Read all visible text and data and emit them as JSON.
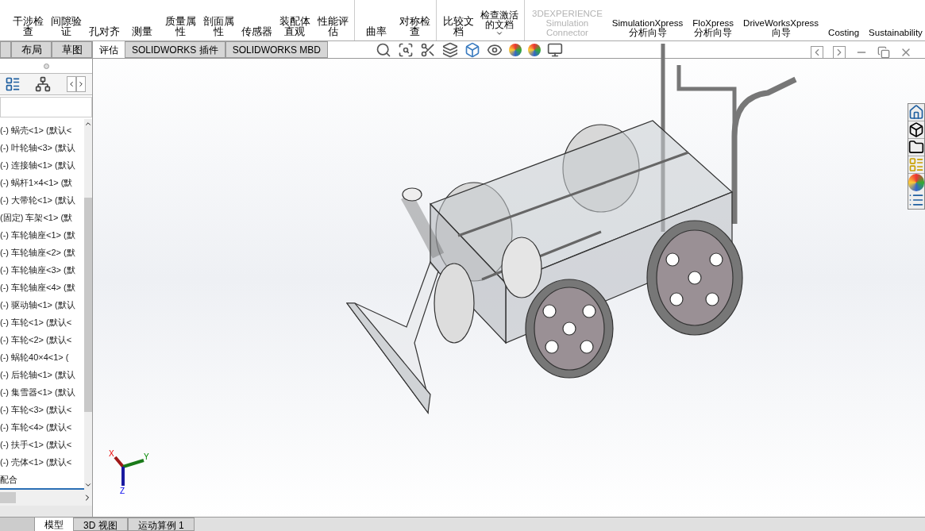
{
  "ribbon": {
    "groups": [
      {
        "kind": "command",
        "tools": [
          {
            "label": "干涉检查",
            "disabled": false,
            "has_menu": false
          },
          {
            "label": "间隙验证",
            "disabled": false,
            "has_menu": false
          },
          {
            "label": "孔对齐",
            "disabled": false,
            "has_menu": false
          },
          {
            "label": "测量",
            "disabled": false,
            "has_menu": false
          },
          {
            "label": "质量属性",
            "disabled": false,
            "has_menu": false
          },
          {
            "label": "剖面属性",
            "disabled": false,
            "has_menu": false
          },
          {
            "label": "传感器",
            "disabled": false,
            "has_menu": false
          },
          {
            "label": "装配体直观",
            "disabled": false,
            "has_menu": false
          },
          {
            "label": "性能评估",
            "disabled": false,
            "has_menu": false
          }
        ]
      },
      {
        "kind": "command",
        "tools": [
          {
            "label": "曲率",
            "disabled": false,
            "has_menu": false
          },
          {
            "label": "对称检查",
            "disabled": false,
            "has_menu": false
          }
        ]
      },
      {
        "kind": "command",
        "tools": [
          {
            "label": "比较文档",
            "disabled": false,
            "has_menu": false
          },
          {
            "label": "检查激活的文档",
            "disabled": false,
            "has_menu": true
          }
        ]
      },
      {
        "kind": "addin",
        "tools": [
          {
            "label": "3DEXPERIENCE Simulation Connector",
            "disabled": true,
            "has_menu": false
          },
          {
            "label": "SimulationXpress 分析向导",
            "disabled": false,
            "has_menu": false
          },
          {
            "label": "FloXpress 分析向导",
            "disabled": false,
            "has_menu": false
          },
          {
            "label": "DriveWorksXpress 向导",
            "disabled": false,
            "has_menu": false
          },
          {
            "label": "Costing",
            "disabled": false,
            "has_menu": false
          },
          {
            "label": "Sustainability",
            "disabled": false,
            "has_menu": false
          }
        ]
      }
    ]
  },
  "tabs": [
    {
      "label": "布局",
      "selected": false
    },
    {
      "label": "草图",
      "selected": false
    },
    {
      "label": "评估",
      "selected": true
    },
    {
      "label": "SOLIDWORKS 插件",
      "selected": false
    },
    {
      "label": "SOLIDWORKS MBD",
      "selected": false
    }
  ],
  "tree": {
    "items": [
      {
        "label": "(-) 蜗壳<1> (默认<"
      },
      {
        "label": "(-) 叶轮轴<3> (默认"
      },
      {
        "label": "(-) 连接轴<1> (默认"
      },
      {
        "label": "(-) 蜗杆1×4<1> (默"
      },
      {
        "label": "(-) 大带轮<1> (默认"
      },
      {
        "label": "(固定) 车架<1> (默"
      },
      {
        "label": "(-) 车轮轴座<1> (默"
      },
      {
        "label": "(-) 车轮轴座<2> (默"
      },
      {
        "label": "(-) 车轮轴座<3> (默"
      },
      {
        "label": "(-) 车轮轴座<4> (默"
      },
      {
        "label": "(-) 驱动轴<1> (默认"
      },
      {
        "label": "(-) 车轮<1> (默认<"
      },
      {
        "label": "(-) 车轮<2> (默认<"
      },
      {
        "label": "(-) 蜗轮40×4<1> ("
      },
      {
        "label": "(-) 后轮轴<1> (默认"
      },
      {
        "label": "(-) 集雪器<1> (默认"
      },
      {
        "label": "(-) 车轮<3> (默认<"
      },
      {
        "label": "(-) 车轮<4> (默认<"
      },
      {
        "label": "(-) 扶手<1> (默认<"
      },
      {
        "label": "(-) 壳体<1> (默认<"
      }
    ],
    "mates": "配合"
  },
  "triad": {
    "x": "X",
    "y": "Y",
    "z": "Z"
  },
  "bottom_tabs": [
    {
      "label": "模型",
      "selected": true
    },
    {
      "label": "3D 视图",
      "selected": false
    },
    {
      "label": "运动算例 1",
      "selected": false
    }
  ]
}
